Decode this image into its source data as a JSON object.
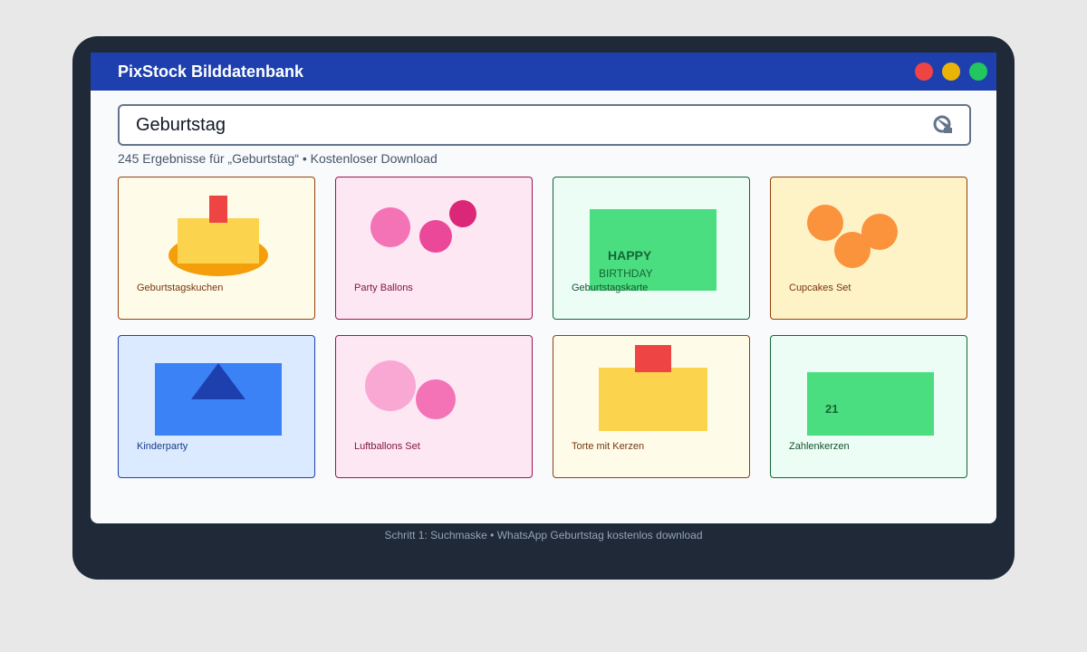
{
  "app": {
    "title": "PixStock Bilddatenbank"
  },
  "window_controls": {
    "close_color": "#ef4444",
    "minimize_color": "#eab308",
    "maximize_color": "#22c55e"
  },
  "search": {
    "value": "Geburtstag",
    "icon": "search-icon"
  },
  "results": {
    "summary": "245 Ergebnisse für „Geburtstag“ • Kostenloser Download"
  },
  "cards": [
    {
      "title": "Geburtstagskuchen"
    },
    {
      "title": "Party Ballons"
    },
    {
      "title": "Geburtstagskarte",
      "card_text_line1": "HAPPY",
      "card_text_line2": "BIRTHDAY"
    },
    {
      "title": "Cupcakes Set"
    },
    {
      "title": "Kinderparty"
    },
    {
      "title": "Luftballons Set"
    },
    {
      "title": "Torte mit Kerzen"
    },
    {
      "title": "Zahlenkerzen",
      "number_text": "21"
    }
  ],
  "footer": {
    "caption": "Schritt 1: Suchmaske • WhatsApp Geburtstag kostenlos download"
  },
  "colors": {
    "header": "#1e40af",
    "device": "#1f2937",
    "screen": "#f8fafc"
  }
}
